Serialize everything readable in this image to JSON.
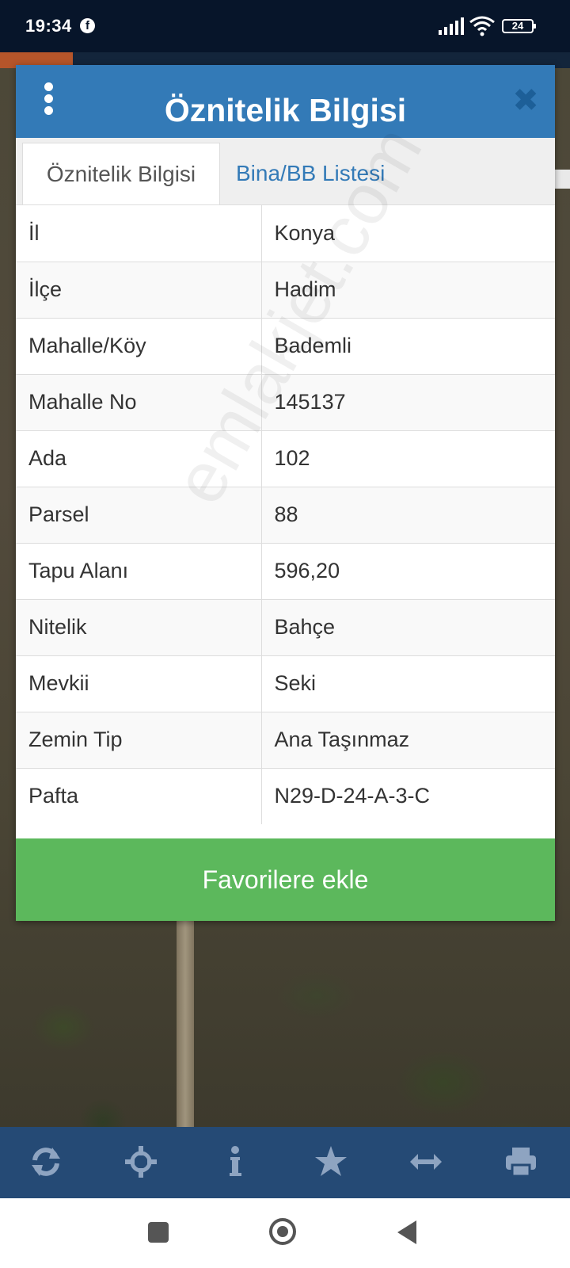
{
  "status_bar": {
    "time": "19:34",
    "battery": "24"
  },
  "modal": {
    "title": "Öznitelik Bilgisi",
    "tabs": [
      {
        "label": "Öznitelik Bilgisi",
        "active": true
      },
      {
        "label": "Bina/BB Listesi",
        "active": false
      }
    ],
    "rows": [
      {
        "key": "İl",
        "value": "Konya"
      },
      {
        "key": "İlçe",
        "value": "Hadim"
      },
      {
        "key": "Mahalle/Köy",
        "value": "Bademli"
      },
      {
        "key": "Mahalle No",
        "value": "145137"
      },
      {
        "key": "Ada",
        "value": "102"
      },
      {
        "key": "Parsel",
        "value": "88"
      },
      {
        "key": "Tapu Alanı",
        "value": "596,20"
      },
      {
        "key": "Nitelik",
        "value": "Bahçe"
      },
      {
        "key": "Mevkii",
        "value": "Seki"
      },
      {
        "key": "Zemin Tip",
        "value": "Ana Taşınmaz"
      },
      {
        "key": "Pafta",
        "value": "N29-D-24-A-3-C"
      }
    ],
    "favorite_button": "Favorilere ekle"
  },
  "watermark": "emlakjet.com",
  "toolbar": {
    "icons": [
      "refresh-icon",
      "crosshair-icon",
      "info-icon",
      "star-icon",
      "arrows-horizontal-icon",
      "print-icon"
    ]
  },
  "colors": {
    "header": "#337ab7",
    "button": "#5cb85c",
    "toolbar": "#254a75",
    "status_bar": "#07152a"
  }
}
